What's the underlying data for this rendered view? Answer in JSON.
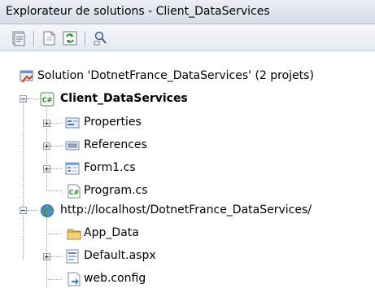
{
  "window": {
    "title": "Explorateur de solutions - Client_DataServices"
  },
  "toolbar": {
    "buttons": [
      {
        "icon": "properties-icon"
      },
      {
        "icon": "show-all-files-icon"
      },
      {
        "icon": "refresh-icon"
      },
      {
        "icon": "view-class-diagram-icon"
      }
    ]
  },
  "tree": {
    "solution_label": "Solution 'DotnetFrance_DataServices' (2 projets)",
    "project1": {
      "label": "Client_DataServices",
      "children": [
        {
          "label": "Properties"
        },
        {
          "label": "References"
        },
        {
          "label": "Form1.cs"
        },
        {
          "label": "Program.cs"
        }
      ]
    },
    "project2": {
      "label": "http://localhost/DotnetFrance_DataServices/",
      "children": [
        {
          "label": "App_Data"
        },
        {
          "label": "Default.aspx"
        },
        {
          "label": "web.config"
        }
      ]
    }
  },
  "colors": {
    "titlebar_bg": "#dfe4ec",
    "toolbar_bg": "#eef1f5",
    "csharp_green": "#2f8a2f",
    "folder_yellow": "#e8c15a"
  }
}
